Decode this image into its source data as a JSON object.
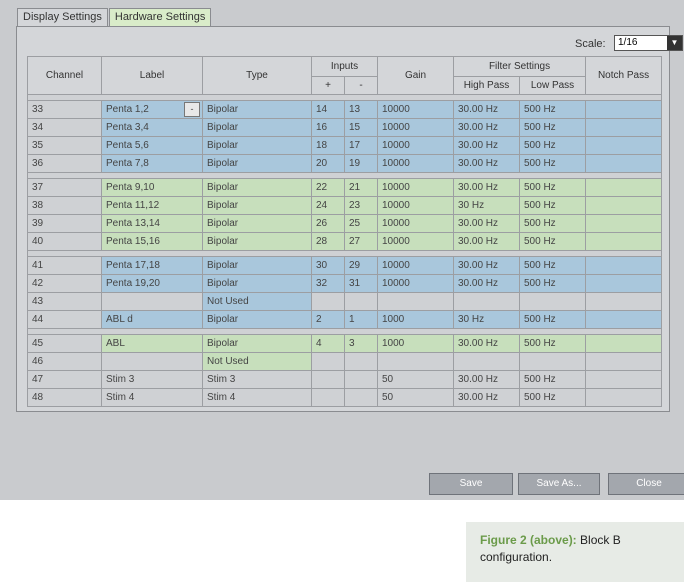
{
  "tabs": [
    {
      "label": "Display Settings",
      "active": false
    },
    {
      "label": "Hardware Settings",
      "active": true
    }
  ],
  "scale": {
    "label": "Scale:",
    "value": "1/16"
  },
  "headers": {
    "channel": "Channel",
    "label": "Label",
    "type": "Type",
    "inputs": "Inputs",
    "plus": "+",
    "minus": "-",
    "gain": "Gain",
    "filter_settings": "Filter Settings",
    "high_pass": "High Pass",
    "low_pass": "Low Pass",
    "notch_pass": "Notch Pass"
  },
  "rows": [
    {
      "channel": "33",
      "label": "Penta 1,2",
      "type": "Bipolar",
      "plus": "14",
      "minus": "13",
      "gain": "10000",
      "high": "30.00 Hz",
      "low": "500 Hz",
      "notch": "",
      "color": "blue",
      "has_dropdown": true,
      "dropdown": "-"
    },
    {
      "channel": "34",
      "label": "Penta 3,4",
      "type": "Bipolar",
      "plus": "16",
      "minus": "15",
      "gain": "10000",
      "high": "30.00 Hz",
      "low": "500 Hz",
      "notch": "",
      "color": "blue"
    },
    {
      "channel": "35",
      "label": "Penta 5,6",
      "type": "Bipolar",
      "plus": "18",
      "minus": "17",
      "gain": "10000",
      "high": "30.00 Hz",
      "low": "500 Hz",
      "notch": "",
      "color": "blue"
    },
    {
      "channel": "36",
      "label": "Penta 7,8",
      "type": "Bipolar",
      "plus": "20",
      "minus": "19",
      "gain": "10000",
      "high": "30.00 Hz",
      "low": "500 Hz",
      "notch": "",
      "color": "blue"
    },
    {
      "gap": true
    },
    {
      "channel": "37",
      "label": "Penta 9,10",
      "type": "Bipolar",
      "plus": "22",
      "minus": "21",
      "gain": "10000",
      "high": "30.00 Hz",
      "low": "500 Hz",
      "notch": "",
      "color": "green"
    },
    {
      "channel": "38",
      "label": "Penta 11,12",
      "type": "Bipolar",
      "plus": "24",
      "minus": "23",
      "gain": "10000",
      "high": "30 Hz",
      "low": "500 Hz",
      "notch": "",
      "color": "green"
    },
    {
      "channel": "39",
      "label": "Penta 13,14",
      "type": "Bipolar",
      "plus": "26",
      "minus": "25",
      "gain": "10000",
      "high": "30.00 Hz",
      "low": "500 Hz",
      "notch": "",
      "color": "green"
    },
    {
      "channel": "40",
      "label": "Penta 15,16",
      "type": "Bipolar",
      "plus": "28",
      "minus": "27",
      "gain": "10000",
      "high": "30.00 Hz",
      "low": "500 Hz",
      "notch": "",
      "color": "green"
    },
    {
      "gap": true
    },
    {
      "channel": "41",
      "label": "Penta 17,18",
      "type": "Bipolar",
      "plus": "30",
      "minus": "29",
      "gain": "10000",
      "high": "30.00 Hz",
      "low": "500 Hz",
      "notch": "",
      "color": "blue"
    },
    {
      "channel": "42",
      "label": "Penta 19,20",
      "type": "Bipolar",
      "plus": "32",
      "minus": "31",
      "gain": "10000",
      "high": "30.00 Hz",
      "low": "500 Hz",
      "notch": "",
      "color": "blue"
    },
    {
      "channel": "43",
      "label": "",
      "type": "Not Used",
      "plus": "",
      "minus": "",
      "gain": "",
      "high": "",
      "low": "",
      "notch": "",
      "color": "typeblue"
    },
    {
      "channel": "44",
      "label": "ABL d",
      "type": "Bipolar",
      "plus": "2",
      "minus": "1",
      "gain": "1000",
      "high": "30 Hz",
      "low": "500 Hz",
      "notch": "",
      "color": "blue"
    },
    {
      "gap": true
    },
    {
      "channel": "45",
      "label": "ABL",
      "type": "Bipolar",
      "plus": "4",
      "minus": "3",
      "gain": "1000",
      "high": "30.00 Hz",
      "low": "500 Hz",
      "notch": "",
      "color": "green"
    },
    {
      "channel": "46",
      "label": "",
      "type": "Not Used",
      "plus": "",
      "minus": "",
      "gain": "",
      "high": "",
      "low": "",
      "notch": "",
      "color": "typegreen"
    },
    {
      "channel": "47",
      "label": "Stim 3",
      "type": "Stim 3",
      "plus": "",
      "minus": "",
      "gain": "50",
      "high": "30.00 Hz",
      "low": "500 Hz",
      "notch": "",
      "color": "gray"
    },
    {
      "channel": "48",
      "label": "Stim 4",
      "type": "Stim 4",
      "plus": "",
      "minus": "",
      "gain": "50",
      "high": "30.00 Hz",
      "low": "500 Hz",
      "notch": "",
      "color": "gray"
    }
  ],
  "buttons": {
    "save": "Save",
    "save_as": "Save As...",
    "close": "Close"
  },
  "caption": {
    "bold": "Figure 2 (above):",
    "text": " Block B configuration."
  },
  "colors": {
    "blue": "#a9c7dc",
    "green": "#c7dfbc",
    "gray": "#cfd1d4"
  }
}
